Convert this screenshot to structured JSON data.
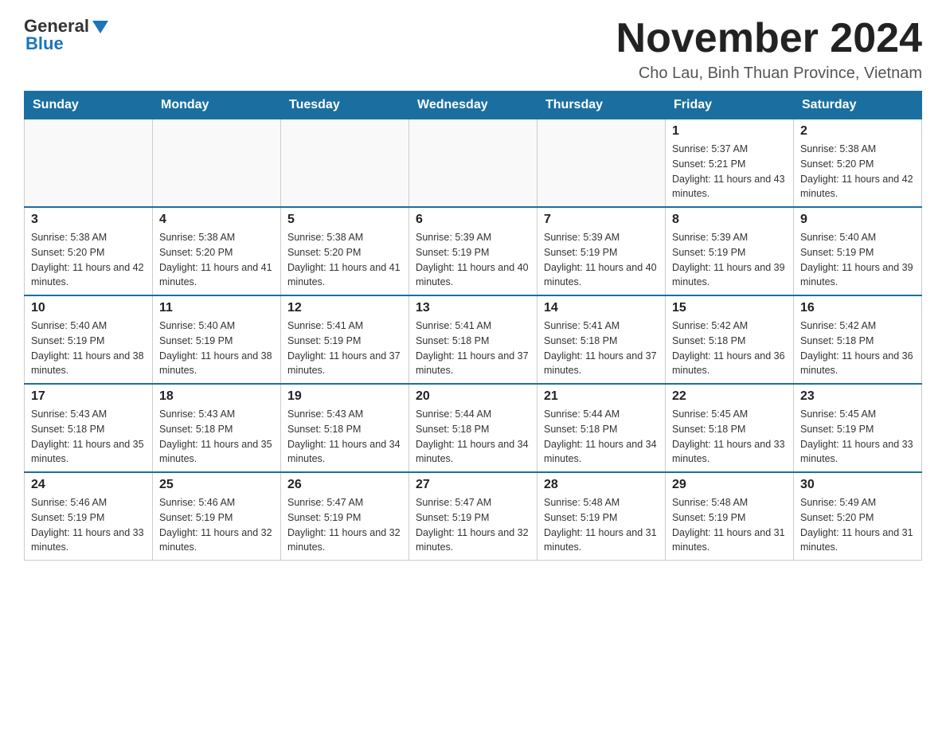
{
  "logo": {
    "general": "General",
    "blue": "Blue"
  },
  "title": "November 2024",
  "location": "Cho Lau, Binh Thuan Province, Vietnam",
  "days_of_week": [
    "Sunday",
    "Monday",
    "Tuesday",
    "Wednesday",
    "Thursday",
    "Friday",
    "Saturday"
  ],
  "weeks": [
    [
      {
        "day": "",
        "info": ""
      },
      {
        "day": "",
        "info": ""
      },
      {
        "day": "",
        "info": ""
      },
      {
        "day": "",
        "info": ""
      },
      {
        "day": "",
        "info": ""
      },
      {
        "day": "1",
        "info": "Sunrise: 5:37 AM\nSunset: 5:21 PM\nDaylight: 11 hours and 43 minutes."
      },
      {
        "day": "2",
        "info": "Sunrise: 5:38 AM\nSunset: 5:20 PM\nDaylight: 11 hours and 42 minutes."
      }
    ],
    [
      {
        "day": "3",
        "info": "Sunrise: 5:38 AM\nSunset: 5:20 PM\nDaylight: 11 hours and 42 minutes."
      },
      {
        "day": "4",
        "info": "Sunrise: 5:38 AM\nSunset: 5:20 PM\nDaylight: 11 hours and 41 minutes."
      },
      {
        "day": "5",
        "info": "Sunrise: 5:38 AM\nSunset: 5:20 PM\nDaylight: 11 hours and 41 minutes."
      },
      {
        "day": "6",
        "info": "Sunrise: 5:39 AM\nSunset: 5:19 PM\nDaylight: 11 hours and 40 minutes."
      },
      {
        "day": "7",
        "info": "Sunrise: 5:39 AM\nSunset: 5:19 PM\nDaylight: 11 hours and 40 minutes."
      },
      {
        "day": "8",
        "info": "Sunrise: 5:39 AM\nSunset: 5:19 PM\nDaylight: 11 hours and 39 minutes."
      },
      {
        "day": "9",
        "info": "Sunrise: 5:40 AM\nSunset: 5:19 PM\nDaylight: 11 hours and 39 minutes."
      }
    ],
    [
      {
        "day": "10",
        "info": "Sunrise: 5:40 AM\nSunset: 5:19 PM\nDaylight: 11 hours and 38 minutes."
      },
      {
        "day": "11",
        "info": "Sunrise: 5:40 AM\nSunset: 5:19 PM\nDaylight: 11 hours and 38 minutes."
      },
      {
        "day": "12",
        "info": "Sunrise: 5:41 AM\nSunset: 5:19 PM\nDaylight: 11 hours and 37 minutes."
      },
      {
        "day": "13",
        "info": "Sunrise: 5:41 AM\nSunset: 5:18 PM\nDaylight: 11 hours and 37 minutes."
      },
      {
        "day": "14",
        "info": "Sunrise: 5:41 AM\nSunset: 5:18 PM\nDaylight: 11 hours and 37 minutes."
      },
      {
        "day": "15",
        "info": "Sunrise: 5:42 AM\nSunset: 5:18 PM\nDaylight: 11 hours and 36 minutes."
      },
      {
        "day": "16",
        "info": "Sunrise: 5:42 AM\nSunset: 5:18 PM\nDaylight: 11 hours and 36 minutes."
      }
    ],
    [
      {
        "day": "17",
        "info": "Sunrise: 5:43 AM\nSunset: 5:18 PM\nDaylight: 11 hours and 35 minutes."
      },
      {
        "day": "18",
        "info": "Sunrise: 5:43 AM\nSunset: 5:18 PM\nDaylight: 11 hours and 35 minutes."
      },
      {
        "day": "19",
        "info": "Sunrise: 5:43 AM\nSunset: 5:18 PM\nDaylight: 11 hours and 34 minutes."
      },
      {
        "day": "20",
        "info": "Sunrise: 5:44 AM\nSunset: 5:18 PM\nDaylight: 11 hours and 34 minutes."
      },
      {
        "day": "21",
        "info": "Sunrise: 5:44 AM\nSunset: 5:18 PM\nDaylight: 11 hours and 34 minutes."
      },
      {
        "day": "22",
        "info": "Sunrise: 5:45 AM\nSunset: 5:18 PM\nDaylight: 11 hours and 33 minutes."
      },
      {
        "day": "23",
        "info": "Sunrise: 5:45 AM\nSunset: 5:19 PM\nDaylight: 11 hours and 33 minutes."
      }
    ],
    [
      {
        "day": "24",
        "info": "Sunrise: 5:46 AM\nSunset: 5:19 PM\nDaylight: 11 hours and 33 minutes."
      },
      {
        "day": "25",
        "info": "Sunrise: 5:46 AM\nSunset: 5:19 PM\nDaylight: 11 hours and 32 minutes."
      },
      {
        "day": "26",
        "info": "Sunrise: 5:47 AM\nSunset: 5:19 PM\nDaylight: 11 hours and 32 minutes."
      },
      {
        "day": "27",
        "info": "Sunrise: 5:47 AM\nSunset: 5:19 PM\nDaylight: 11 hours and 32 minutes."
      },
      {
        "day": "28",
        "info": "Sunrise: 5:48 AM\nSunset: 5:19 PM\nDaylight: 11 hours and 31 minutes."
      },
      {
        "day": "29",
        "info": "Sunrise: 5:48 AM\nSunset: 5:19 PM\nDaylight: 11 hours and 31 minutes."
      },
      {
        "day": "30",
        "info": "Sunrise: 5:49 AM\nSunset: 5:20 PM\nDaylight: 11 hours and 31 minutes."
      }
    ]
  ]
}
